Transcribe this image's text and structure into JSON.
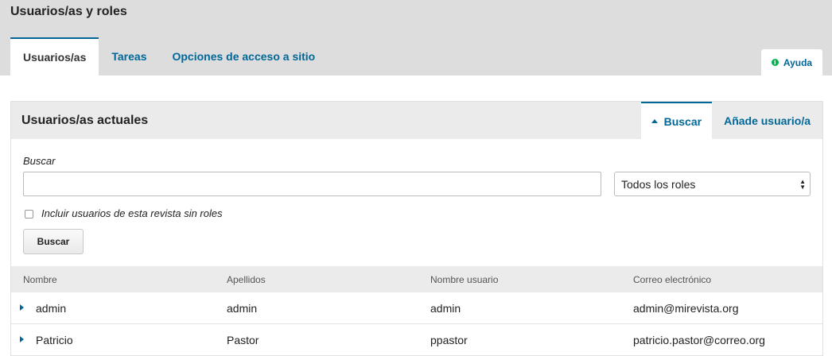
{
  "page": {
    "title": "Usuarios/as y roles"
  },
  "tabs": [
    {
      "label": "Usuarios/as"
    },
    {
      "label": "Tareas"
    },
    {
      "label": "Opciones de acceso a sitio"
    }
  ],
  "help": {
    "label": "Ayuda"
  },
  "panel": {
    "title": "Usuarios/as actuales",
    "tabs": [
      {
        "label": "Buscar"
      },
      {
        "label": "Añade usuario/a"
      }
    ]
  },
  "search": {
    "label": "Buscar",
    "input_value": "",
    "role_select": "Todos los roles",
    "checkbox_label": "Incluir usuarios de esta revista sin roles",
    "button_label": "Buscar"
  },
  "table": {
    "headers": [
      "Nombre",
      "Apellidos",
      "Nombre usuario",
      "Correo electrónico"
    ],
    "rows": [
      [
        "admin",
        "admin",
        "admin",
        "admin@mirevista.org"
      ],
      [
        "Patricio",
        "Pastor",
        "ppastor",
        "patricio.pastor@correo.org"
      ]
    ]
  },
  "colors": {
    "accent": "#006798",
    "help_icon": "#00b24e"
  }
}
